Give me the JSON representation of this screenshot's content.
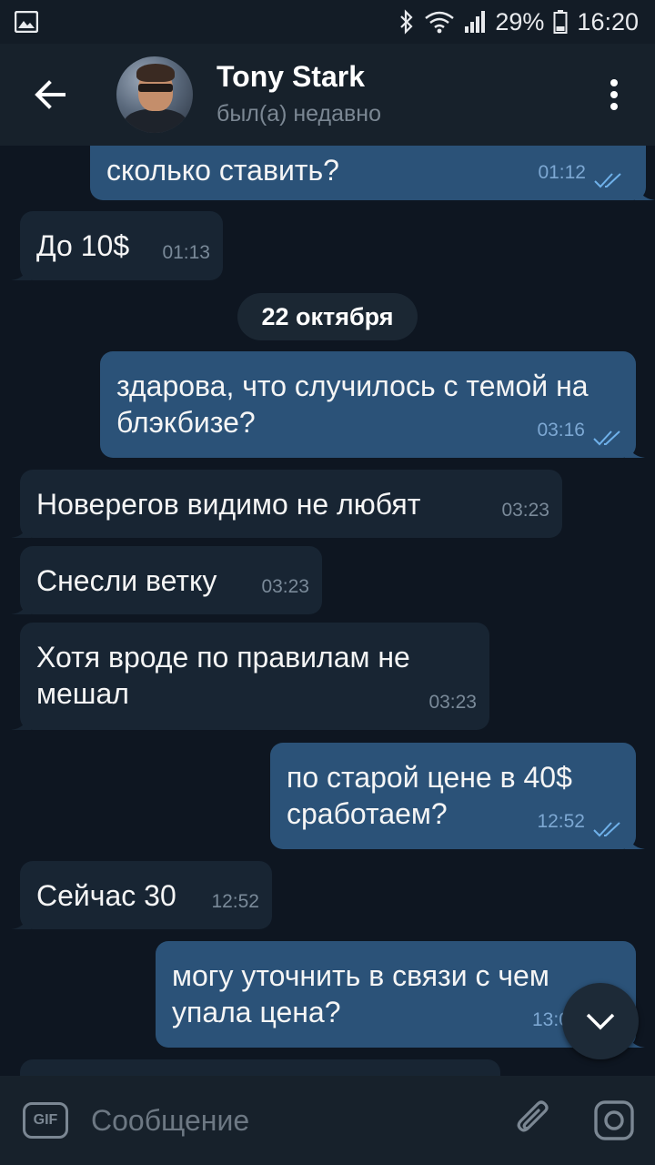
{
  "status_bar": {
    "battery": "29%",
    "time": "16:20",
    "icons": [
      "image-notification-icon",
      "bluetooth-icon",
      "wifi-icon",
      "signal-icon",
      "battery-icon"
    ]
  },
  "header": {
    "contact_name": "Tony Stark",
    "contact_status": "был(а) недавно",
    "icons": [
      "back-arrow-icon",
      "avatar",
      "more-vert-icon"
    ]
  },
  "messages": [
    {
      "direction": "out",
      "text": "сколько ставить?",
      "time": "01:12",
      "read": true
    },
    {
      "direction": "in",
      "text": "До 10$",
      "time": "01:13"
    },
    {
      "direction": "out",
      "text": "здарова, что случилось с темой на блэкбизе?",
      "time": "03:16",
      "read": true
    },
    {
      "direction": "in",
      "text": "Новерегов видимо не любят",
      "time": "03:23"
    },
    {
      "direction": "in",
      "text": "Снесли ветку",
      "time": "03:23"
    },
    {
      "direction": "in",
      "text": "Хотя вроде по правилам не мешал",
      "time": "03:23"
    },
    {
      "direction": "out",
      "text": "по старой цене в 40$ сработаем?",
      "time": "12:52",
      "read": true
    },
    {
      "direction": "in",
      "text": "Сейчас 30",
      "time": "12:52"
    },
    {
      "direction": "out",
      "text": "могу уточнить в связи с чем упала цена?",
      "time": "13:0",
      "read": true
    }
  ],
  "date_separator": "22 октября",
  "composer": {
    "gif_label": "GIF",
    "placeholder": "Сообщение",
    "icons": [
      "gif-icon",
      "attach-icon",
      "camera-icon"
    ]
  },
  "colors": {
    "background": "#0e1621",
    "header": "#17212b",
    "incoming_bubble": "#182533",
    "outgoing_bubble": "#2b5278",
    "check_marks": "#6fb1ea"
  }
}
